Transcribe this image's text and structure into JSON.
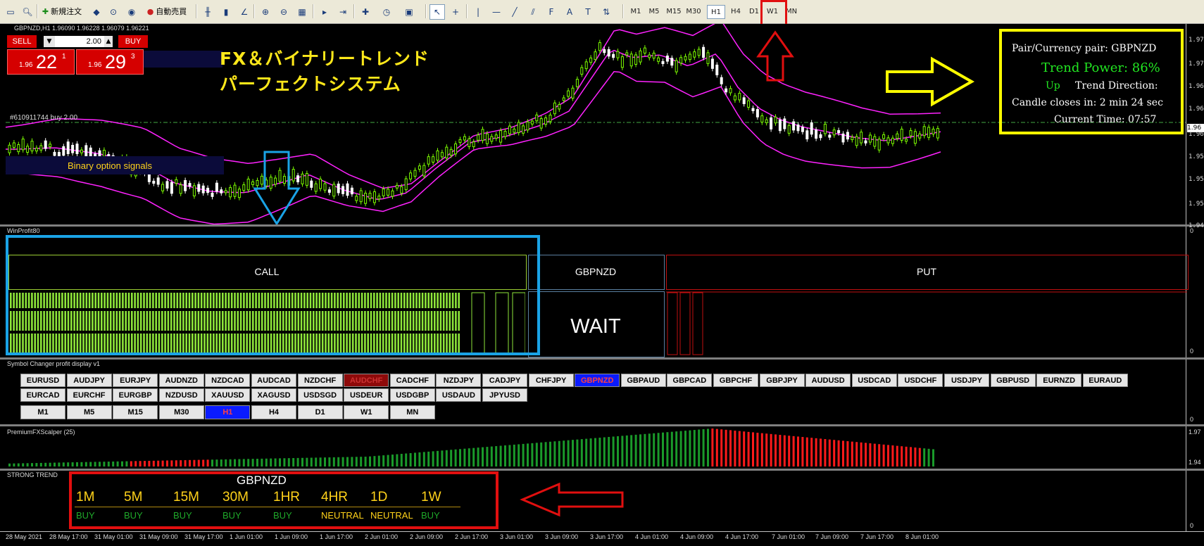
{
  "toolbar": {
    "new_order": "新規注文",
    "auto_trading": "自動売買",
    "timeframes": [
      "M1",
      "M5",
      "M15",
      "M30",
      "H1",
      "H4",
      "D1",
      "W1",
      "MN"
    ],
    "active_timeframe": "H1"
  },
  "chart": {
    "header": "GBPNZD,H1  1.96090 1.96228 1.96079 1.96221",
    "order_line": "#610911744 buy 2.00",
    "overlay_title_line1": "FX＆バイナリートレンド",
    "overlay_title_line2": "パーフェクトシステム",
    "binary_label": "Binary option signals",
    "price_scale": [
      "1.97",
      "1.97",
      "1.96",
      "1.96",
      "1.96",
      "1.95",
      "1.95",
      "1.95",
      "1.94"
    ],
    "current_price": "1.96",
    "colors": {
      "bands": "#ff22ff",
      "bull": "#7CFC00",
      "bear": "#ffffff",
      "order_line": "#44aa44"
    }
  },
  "trade_panel": {
    "sell_label": "SELL",
    "buy_label": "BUY",
    "lot": "2.00",
    "sell_prefix": "1.96",
    "sell_big": "22",
    "sell_sup": "1",
    "buy_prefix": "1.96",
    "buy_big": "29",
    "buy_sup": "3"
  },
  "info_box": {
    "pair": "Pair/Currency pair: GBPNZD",
    "trend_power": "Trend Power: 86%",
    "direction_value": "Up",
    "direction_label": "Trend Direction:",
    "candle": "Candle closes in: 2 min 24 sec",
    "time": "Current Time: 07:57",
    "border_color": "#ffff00"
  },
  "winprofit": {
    "title": "WinProfit80",
    "call": "CALL",
    "pair": "GBPNZD",
    "put": "PUT",
    "state": "WAIT",
    "scale_top": "0",
    "scale_bottom": "0"
  },
  "symbol_changer": {
    "title": "Symbol Changer profit display v1",
    "row1": [
      "EURUSD",
      "AUDJPY",
      "EURJPY",
      "AUDNZD",
      "NZDCAD",
      "AUDCAD",
      "NZDCHF",
      "AUDCHF",
      "CADCHF",
      "NZDJPY",
      "CADJPY",
      "CHFJPY",
      "GBPNZD",
      "GBPAUD",
      "GBPCAD",
      "GBPCHF",
      "GBPJPY",
      "AUDUSD",
      "USDCAD",
      "USDCHF",
      "USDJPY",
      "GBPUSD",
      "EURNZD",
      "EURAUD"
    ],
    "row2": [
      "EURCAD",
      "EURCHF",
      "EURGBP",
      "NZDUSD",
      "XAUUSD",
      "XAGUSD",
      "USDSGD",
      "USDEUR",
      "USDGBP",
      "USDAUD",
      "JPYUSD"
    ],
    "row3": [
      "M1",
      "M5",
      "M15",
      "M30",
      "H1",
      "H4",
      "D1",
      "W1",
      "MN"
    ],
    "highlight_red": "AUDCHF",
    "highlight_blue": "GBPNZD",
    "active_tf": "H1",
    "scale": "0"
  },
  "scalper": {
    "title": "PremiumFXScalper (25)",
    "scale_top": "1.97",
    "scale_bottom": "1.94"
  },
  "strong_trend": {
    "title": "STRONG TREND",
    "pair": "GBPNZD",
    "timeframes": [
      "1M",
      "5M",
      "15M",
      "30M",
      "1HR",
      "4HR",
      "1D",
      "1W"
    ],
    "signals": [
      "BUY",
      "BUY",
      "BUY",
      "BUY",
      "BUY",
      "NEUTRAL",
      "NEUTRAL",
      "BUY"
    ],
    "scale": "0"
  },
  "x_axis": [
    "28 May 2021",
    "28 May 17:00",
    "31 May 01:00",
    "31 May 09:00",
    "31 May 17:00",
    "1 Jun 01:00",
    "1 Jun 09:00",
    "1 Jun 17:00",
    "2 Jun 01:00",
    "2 Jun 09:00",
    "2 Jun 17:00",
    "3 Jun 01:00",
    "3 Jun 09:00",
    "3 Jun 17:00",
    "4 Jun 01:00",
    "4 Jun 09:00",
    "4 Jun 17:00",
    "7 Jun 01:00",
    "7 Jun 09:00",
    "7 Jun 17:00",
    "8 Jun 01:00"
  ]
}
